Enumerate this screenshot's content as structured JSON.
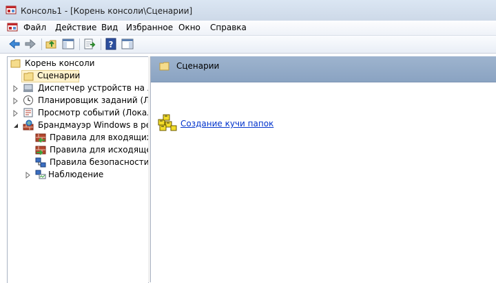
{
  "window": {
    "title": "Консоль1 - [Корень консоли\\Сценарии]"
  },
  "menu": {
    "items": [
      "Файл",
      "Действие",
      "Вид",
      "Избранное",
      "Окно",
      "Справка"
    ]
  },
  "tree": {
    "items": [
      {
        "label": "Корень консоли",
        "icon": "folder-icon"
      },
      {
        "label": "Сценарии",
        "icon": "folder-icon",
        "selected": true
      },
      {
        "label": "Диспетчер устройств на лока",
        "icon": "device-manager-icon"
      },
      {
        "label": "Планировщик заданий (Лока",
        "icon": "clock-icon"
      },
      {
        "label": "Просмотр событий (Локальн",
        "icon": "event-viewer-icon"
      },
      {
        "label": "Брандмауэр Windows в режи",
        "icon": "firewall-icon"
      },
      {
        "label": "Правила для входящих по",
        "icon": "inbound-rules-icon"
      },
      {
        "label": "Правила для исходящего",
        "icon": "outbound-rules-icon"
      },
      {
        "label": "Правила безопасности по",
        "icon": "connection-security-icon"
      },
      {
        "label": "Наблюдение",
        "icon": "monitoring-icon"
      }
    ]
  },
  "content": {
    "header": "Сценарии",
    "task_link": "Создание кучи папок"
  },
  "colors": {
    "header_bg": "#94acc8",
    "link": "#0033cc"
  }
}
